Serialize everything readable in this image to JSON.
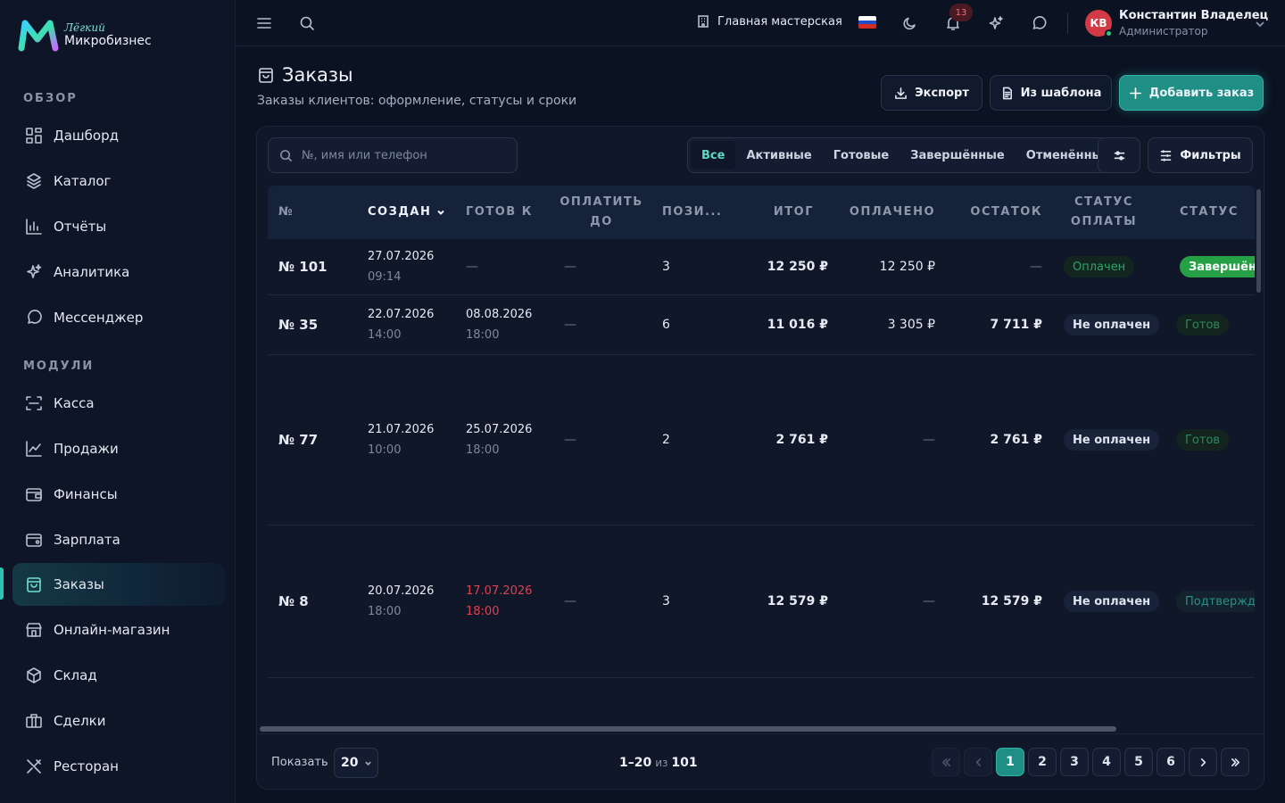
{
  "app": {
    "logo_sub": "Лёгкий",
    "logo_main": "Микробизнес",
    "accent": "#2cc4b0"
  },
  "sidebar": {
    "sections": [
      {
        "title": "ОБЗОР",
        "items": [
          {
            "label": "Дашборд",
            "icon": "dashboard-icon"
          },
          {
            "label": "Каталог",
            "icon": "catalog-icon"
          },
          {
            "label": "Отчёты",
            "icon": "reports-icon"
          },
          {
            "label": "Аналитика",
            "icon": "analytics-icon"
          },
          {
            "label": "Мессенджер",
            "icon": "messenger-icon"
          }
        ]
      },
      {
        "title": "МОДУЛИ",
        "items": [
          {
            "label": "Касса",
            "icon": "cashbox-icon"
          },
          {
            "label": "Продажи",
            "icon": "sales-icon"
          },
          {
            "label": "Финансы",
            "icon": "finance-icon"
          },
          {
            "label": "Зарплата",
            "icon": "salary-icon"
          },
          {
            "label": "Заказы",
            "icon": "orders-icon",
            "active": true
          },
          {
            "label": "Онлайн-магазин",
            "icon": "store-icon"
          },
          {
            "label": "Склад",
            "icon": "warehouse-icon"
          },
          {
            "label": "Сделки",
            "icon": "deals-icon"
          },
          {
            "label": "Ресторан",
            "icon": "restaurant-icon"
          }
        ]
      }
    ]
  },
  "topbar": {
    "workshop": "Главная мастерская",
    "notifications_count": "13",
    "user": {
      "initials": "КВ",
      "name": "Константин Владелец",
      "role": "Администратор"
    }
  },
  "page": {
    "title": "Заказы",
    "subtitle": "Заказы клиентов: оформление, статусы и сроки",
    "buttons": {
      "export": "Экспорт",
      "template": "Из шаблона",
      "add": "Добавить заказ"
    }
  },
  "toolbar": {
    "search_placeholder": "№, имя или телефон",
    "tabs": [
      "Все",
      "Активные",
      "Готовые",
      "Завершённые",
      "Отменённые"
    ],
    "active_tab": "Все",
    "filters_label": "Фильтры"
  },
  "table": {
    "headers": {
      "no": "№",
      "created": "СОЗДАН",
      "ready": "ГОТОВ К",
      "pay_by_1": "ОПЛАТИТЬ",
      "pay_by_2": "ДО",
      "positions": "ПОЗИ...",
      "total": "ИТОГ",
      "paid": "ОПЛАЧЕНО",
      "rest": "ОСТАТОК",
      "pay_status_1": "СТАТУС",
      "pay_status_2": "ОПЛАТЫ",
      "status": "СТАТУС"
    },
    "rows": [
      {
        "no": "№ 101",
        "created_d": "27.07.2026",
        "created_t": "09:14",
        "ready_d": "",
        "ready_t": "",
        "pay_by": "—",
        "positions": "3",
        "total": "12 250 ₽",
        "paid": "12 250 ₽",
        "rest": "—",
        "pay_status": "Оплачен",
        "status": "Завершён"
      },
      {
        "no": "№ 35",
        "created_d": "22.07.2026",
        "created_t": "14:00",
        "ready_d": "08.08.2026",
        "ready_t": "18:00",
        "pay_by": "—",
        "positions": "6",
        "total": "11 016 ₽",
        "paid": "3 305 ₽",
        "rest": "7 711 ₽",
        "pay_status": "Не оплачен",
        "status": "Готов"
      },
      {
        "no": "№ 77",
        "created_d": "21.07.2026",
        "created_t": "10:00",
        "ready_d": "25.07.2026",
        "ready_t": "18:00",
        "pay_by": "—",
        "positions": "2",
        "total": "2 761 ₽",
        "paid": "—",
        "rest": "2 761 ₽",
        "pay_status": "Не оплачен",
        "status": "Готов"
      },
      {
        "no": "№ 8",
        "created_d": "20.07.2026",
        "created_t": "18:00",
        "ready_d": "17.07.2026",
        "ready_t": "18:00",
        "pay_by": "—",
        "positions": "3",
        "total": "12 579 ₽",
        "paid": "—",
        "rest": "12 579 ₽",
        "pay_status": "Не оплачен",
        "status": "Подтвержд"
      }
    ],
    "ready_empty": "—"
  },
  "footer": {
    "show_label": "Показать",
    "page_size": "20",
    "range": "1–20",
    "of": "из",
    "total": "101",
    "pages": [
      "1",
      "2",
      "3",
      "4",
      "5",
      "6"
    ],
    "current_page": "1"
  }
}
